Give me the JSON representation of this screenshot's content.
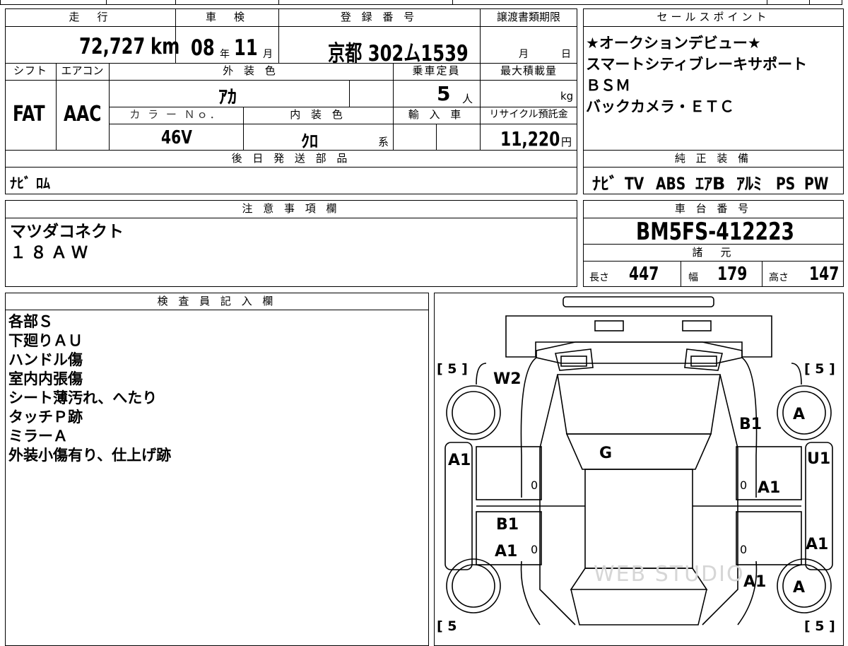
{
  "header": {
    "mileage_label": "走　行",
    "mileage_value": "72,727",
    "mileage_unit": "km",
    "inspection_label": "車　検",
    "inspection_year": "08",
    "inspection_year_unit": "年",
    "inspection_month": "11",
    "inspection_month_unit": "月",
    "registration_label": "登 録 番 号",
    "registration_value": "京都 302ム1539",
    "transfer_label": "譲渡書類期限",
    "transfer_month": "月",
    "transfer_day": "日"
  },
  "sales": {
    "label": "セールスポイント",
    "lines": [
      "★オークションデビュー★",
      "スマートシティブレーキサポート",
      "ＢＳＭ",
      "バックカメラ・ＥＴＣ"
    ]
  },
  "specs": {
    "shift_label": "シフト",
    "shift_value": "FAT",
    "ac_label": "エアコン",
    "ac_value": "AAC",
    "exterior_label": "外 装 色",
    "exterior_value": "ｱｶ",
    "capacity_label": "乗車定員",
    "capacity_value": "5",
    "capacity_unit": "人",
    "maxload_label": "最大積載量",
    "maxload_unit": "kg",
    "color_no_label": "カ ラ ー Ｎｏ．",
    "color_no_value": "46V",
    "interior_label": "内 装 色",
    "interior_value": "ｸﾛ",
    "interior_suffix": "系",
    "import_label": "輸 入 車",
    "recycle_label": "リサイクル預託金",
    "recycle_value": "11,220",
    "recycle_unit": "円"
  },
  "later_parts": {
    "label": "後 日 発 送 部 品",
    "value": "ﾅﾋﾞ ﾛﾑ"
  },
  "genuine_equipment": {
    "label": "純 正 装 備",
    "items": [
      "ﾅﾋﾞ",
      "TV",
      "ABS",
      "ｴｱB",
      "ｱﾙﾐ",
      "PS",
      "PW"
    ]
  },
  "notes": {
    "label": "注 意 事 項 欄",
    "lines": [
      "マツダコネクト",
      "１８ＡＷ"
    ]
  },
  "chassis": {
    "label": "車 台 番 号",
    "value": "BM5FS-412223"
  },
  "dimensions": {
    "label": "諸　元",
    "length_label": "長さ",
    "length_value": "447",
    "width_label": "幅",
    "width_value": "179",
    "height_label": "高さ",
    "height_value": "147"
  },
  "inspector": {
    "label": "検 査 員 記 入 欄",
    "lines": [
      "各部Ｓ",
      "下廻りＡＵ",
      "ハンドル傷",
      "室内内張傷",
      "シート薄汚れ、へたり",
      "タッチＰ跡",
      "ミラーＡ",
      "外装小傷有り、仕上げ跡"
    ]
  },
  "car_diagram": {
    "tire_tl": "[ 5 ]",
    "tire_tr": "[ 5 ]",
    "tire_bl": "[ 5",
    "tire_br": "[ 5 ]",
    "w2": "W2",
    "b1_right": "B1",
    "a_wheel_fr": "A",
    "a1_left": "A1",
    "u1": "U1",
    "g_roof": "G",
    "zero_1": "0",
    "a1_right_door": "A1",
    "b1_left_rear": "B1",
    "a1_left_rear": "A1",
    "zero_2": "0",
    "zero_3": "0",
    "zero_4": "0",
    "a1_right_side": "A1",
    "a1_right_rear": "A1",
    "a_wheel_rr": "A",
    "watermark": "WEB STUDIO"
  }
}
